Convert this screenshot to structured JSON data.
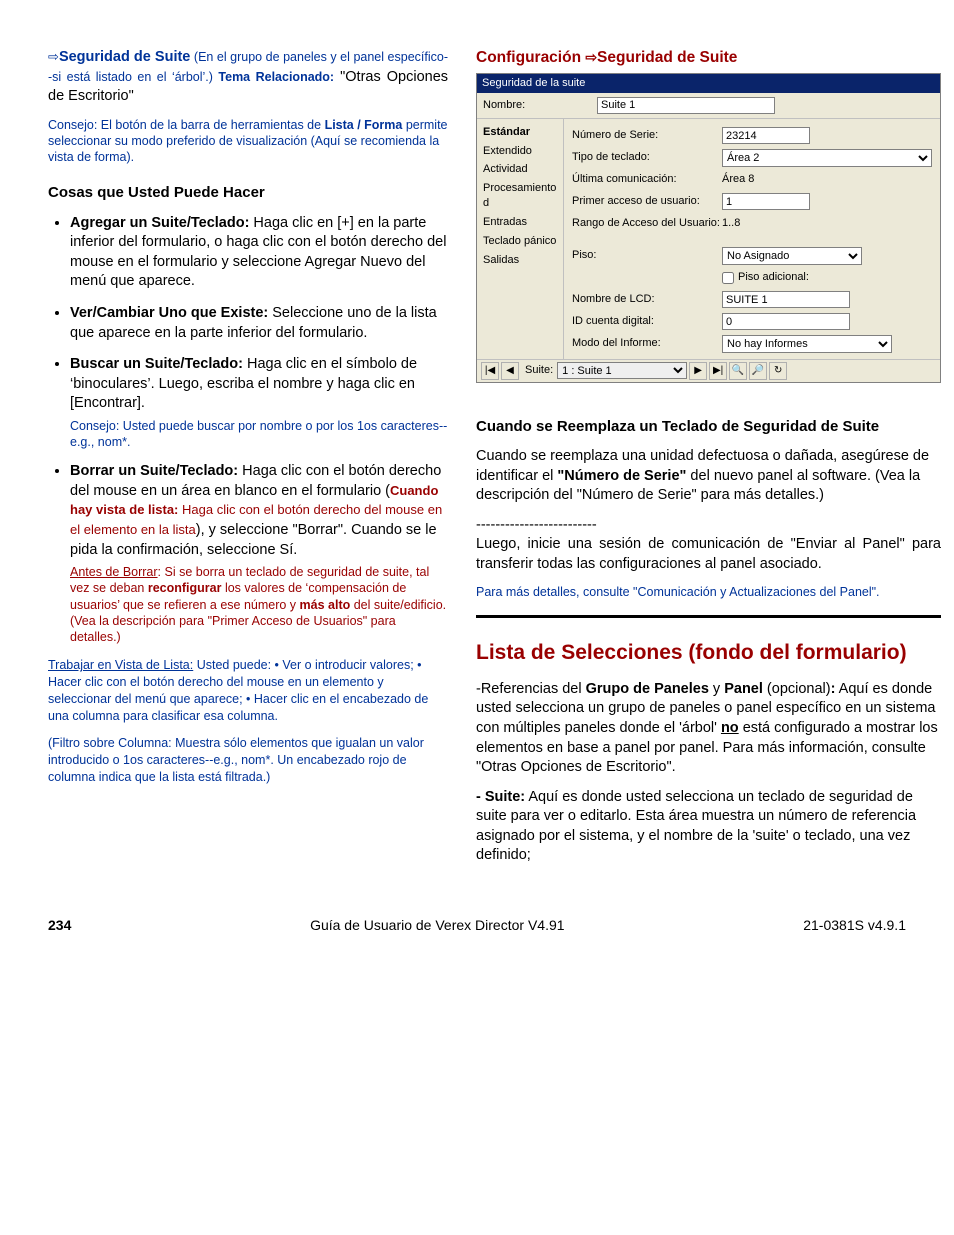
{
  "left": {
    "lead_arrow": "⇨",
    "lead_bold": "Seguridad de Suite",
    "lead_rest_1": "  (En el grupo de paneles y el panel específico--si está listado en el ‘árbol’.)   ",
    "lead_rel_label": "Tema Relacionado:",
    "lead_rel_value": "\"Otras Opciones de Escritorio\"",
    "tip1_a": "Consejo:  El botón de la barra de herramientas de ",
    "tip1_bold": "Lista / Forma",
    "tip1_b": " permite seleccionar su modo preferido de visualización (Aquí se recomienda la vista de forma).",
    "h_things": "Cosas que Usted Puede Hacer",
    "b1_bold": "Agregar un Suite/Teclado:",
    "b1_txt": "  Haga clic en [+] en la parte inferior del formulario, o haga clic con el botón derecho del mouse en el formulario y seleccione Agregar Nuevo del menú que aparece.",
    "b2_bold": "Ver/Cambiar Uno que Existe:",
    "b2_txt": "  Seleccione uno de la lista que aparece en la parte inferior del formulario.",
    "b3_bold": "Buscar un Suite/Teclado:",
    "b3_txt": "  Haga clic en el símbolo de ‘binoculares’.  Luego, escriba el nombre y haga clic en [Encontrar].",
    "b3_tip": "Consejo:  Usted puede buscar por nombre o por los 1os caracteres--e.g., nom*.",
    "b4_bold": "Borrar un Suite/Teclado:",
    "b4_txt_a": "  Haga clic con el botón derecho del mouse en un área en blanco en el formulario (",
    "b4_red_a": "Cuando hay vista de lista:",
    "b4_red_b": " Haga clic con el botón derecho del mouse en el elemento en la lista",
    "b4_txt_b": "), y seleccione \"Borrar\".  Cuando se le pida la confirmación, seleccione Sí.",
    "b4_before_u": "Antes de Borrar",
    "b4_before_a": ":  Si se borra un teclado de seguridad de suite, tal vez se deban ",
    "b4_before_bold1": "reconfigurar",
    "b4_before_b": " los valores de ‘compensación de usuarios’ que se refieren a ese número y ",
    "b4_before_bold2": "más alto",
    "b4_before_c": " del suite/edificio.  (Vea la descripción para \"Primer Acceso de Usuarios\" para detalles.)",
    "listview_u": "Trabajar en Vista de Lista:",
    "listview_txt": "  Usted puede:  • Ver o introducir valores;  • Hacer clic con el botón derecho del mouse en un elemento y seleccionar del menú que aparece;  • Hacer clic en el encabezado de una columna para clasificar esa columna.",
    "filter_txt": "(Filtro sobre Columna:  Muestra sólo elementos que igualan un valor introducido o 1os caracteres--e.g., nom*.  Un encabezado rojo de columna indica que la lista está filtrada.)"
  },
  "right": {
    "config_a": "Configuración ",
    "config_arrow": "⇨",
    "config_b": "Seguridad de Suite",
    "h_replace": "Cuando se Reemplaza un Teclado de Seguridad de Suite",
    "p_replace_a": "Cuando se reemplaza una unidad defectuosa o dañada, asegúrese de identificar el ",
    "p_replace_bold": "\"Número de Serie\"",
    "p_replace_b": " del nuevo panel al software.  (Vea la descripción del \"Número de Serie\" para más detalles.)",
    "dashes": "-------------------------",
    "p_then": "Luego, inicie una sesión de comunicación de \"Enviar al Panel\" para transferir todas las configuraciones al panel asociado.",
    "p_details": "Para más detalles, consulte \"Comunicación y Actualizaciones del Panel\".",
    "h_pick": "Lista de Selecciones (fondo del formulario)",
    "pick1_lead": "-Referencias del ",
    "pick1_b1": "Grupo de Paneles",
    "pick1_mid": " y ",
    "pick1_b2": "Panel",
    "pick1_opt": " (opcional)",
    "pick1_colon": ":",
    "pick1_txt_a": " Aquí es donde usted selecciona un grupo de paneles o panel específico en un sistema con múltiples paneles donde el 'árbol' ",
    "pick1_no": "no",
    "pick1_txt_b": " está configurado a mostrar los elementos en base a panel por panel.  Para más información, consulte \"Otras Opciones de Escritorio\".",
    "pick2_lead": "- Suite:",
    "pick2_txt": " Aquí es donde usted selecciona un teclado de seguridad de suite para ver o editarlo. Esta área muestra un número de referencia asignado por el sistema, y el nombre de la 'suite' o teclado, una vez definido;"
  },
  "shot": {
    "title": "Seguridad de la suite",
    "name_lbl": "Nombre:",
    "name_val": "Suite 1",
    "tabs": [
      "Estándar",
      "Extendido",
      "Actividad",
      "Procesamiento d",
      "Entradas",
      "Teclado pánico",
      "Salidas"
    ],
    "rows": {
      "serial_lbl": "Número de Serie:",
      "serial_val": "23214",
      "kb_lbl": "Tipo de teclado:",
      "kb_val": "Área 2",
      "comm_lbl": "Última comunicación:",
      "comm_val": "Área 8",
      "first_lbl": "Primer acceso de usuario:",
      "first_val": "1",
      "range_lbl": "Rango de Acceso del Usuario:",
      "range_val": "1..8",
      "floor_lbl": "Piso:",
      "floor_val": "No Asignado",
      "extra_lbl": "Piso adicional:",
      "lcd_lbl": "Nombre de LCD:",
      "lcd_val": "SUITE 1",
      "acct_lbl": "ID cuenta digital:",
      "acct_val": "0",
      "rep_lbl": "Modo del Informe:",
      "rep_val": "No hay Informes"
    },
    "nav_lbl": "Suite:",
    "nav_val": "1 : Suite 1"
  },
  "footer": {
    "page": "234",
    "center": "Guía de Usuario de Verex Director V4.91",
    "right": "21-0381S v4.9.1"
  }
}
